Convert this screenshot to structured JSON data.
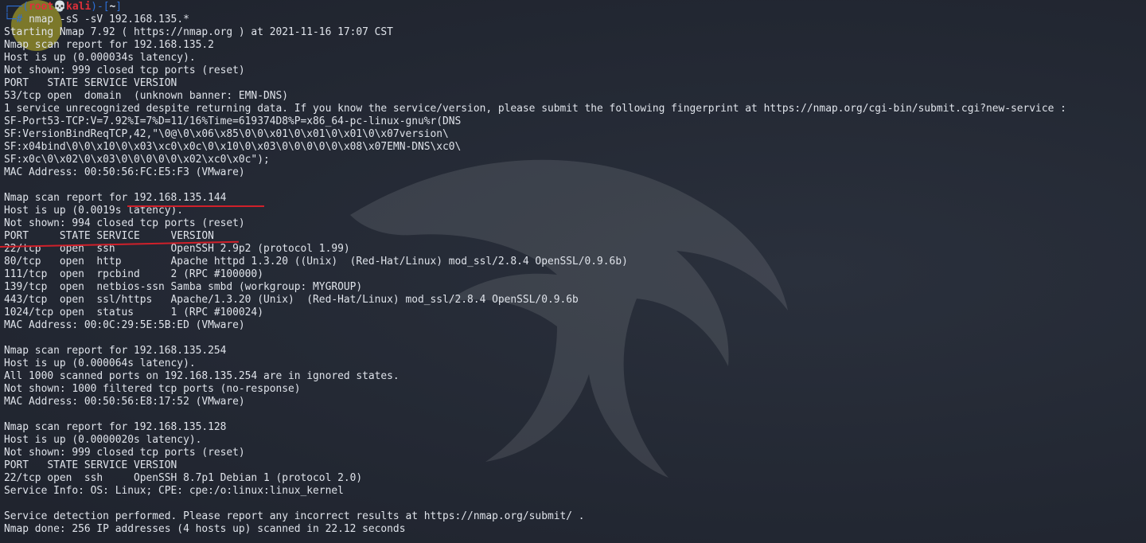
{
  "prompt": {
    "open": "┌──(",
    "user": "root",
    "skull": "💀",
    "host": "kali",
    "close": ")-[",
    "dir": "~",
    "end": "]",
    "corner": "└─",
    "hash": "# ",
    "command": "nmap -sS -sV 192.168.135.*"
  },
  "output": [
    "Starting Nmap 7.92 ( https://nmap.org ) at 2021-11-16 17:07 CST",
    "Nmap scan report for 192.168.135.2",
    "Host is up (0.000034s latency).",
    "Not shown: 999 closed tcp ports (reset)",
    "PORT   STATE SERVICE VERSION",
    "53/tcp open  domain  (unknown banner: EMN-DNS)",
    "1 service unrecognized despite returning data. If you know the service/version, please submit the following fingerprint at https://nmap.org/cgi-bin/submit.cgi?new-service :",
    "SF-Port53-TCP:V=7.92%I=7%D=11/16%Time=619374D8%P=x86_64-pc-linux-gnu%r(DNS",
    "SF:VersionBindReqTCP,42,\"\\0@\\0\\x06\\x85\\0\\0\\x01\\0\\x01\\0\\x01\\0\\x07version\\",
    "SF:x04bind\\0\\0\\x10\\0\\x03\\xc0\\x0c\\0\\x10\\0\\x03\\0\\0\\0\\0\\0\\x08\\x07EMN-DNS\\xc0\\",
    "SF:x0c\\0\\x02\\0\\x03\\0\\0\\0\\0\\0\\x02\\xc0\\x0c\");",
    "MAC Address: 00:50:56:FC:E5:F3 (VMware)",
    "",
    "Nmap scan report for 192.168.135.144",
    "Host is up (0.0019s latency).",
    "Not shown: 994 closed tcp ports (reset)",
    "PORT     STATE SERVICE     VERSION",
    "22/tcp   open  ssh         OpenSSH 2.9p2 (protocol 1.99)",
    "80/tcp   open  http        Apache httpd 1.3.20 ((Unix)  (Red-Hat/Linux) mod_ssl/2.8.4 OpenSSL/0.9.6b)",
    "111/tcp  open  rpcbind     2 (RPC #100000)",
    "139/tcp  open  netbios-ssn Samba smbd (workgroup: MYGROUP)",
    "443/tcp  open  ssl/https   Apache/1.3.20 (Unix)  (Red-Hat/Linux) mod_ssl/2.8.4 OpenSSL/0.9.6b",
    "1024/tcp open  status      1 (RPC #100024)",
    "MAC Address: 00:0C:29:5E:5B:ED (VMware)",
    "",
    "Nmap scan report for 192.168.135.254",
    "Host is up (0.000064s latency).",
    "All 1000 scanned ports on 192.168.135.254 are in ignored states.",
    "Not shown: 1000 filtered tcp ports (no-response)",
    "MAC Address: 00:50:56:E8:17:52 (VMware)",
    "",
    "Nmap scan report for 192.168.135.128",
    "Host is up (0.0000020s latency).",
    "Not shown: 999 closed tcp ports (reset)",
    "PORT   STATE SERVICE VERSION",
    "22/tcp open  ssh     OpenSSH 8.7p1 Debian 1 (protocol 2.0)",
    "Service Info: OS: Linux; CPE: cpe:/o:linux:linux_kernel",
    "",
    "Service detection performed. Please report any incorrect results at https://nmap.org/submit/ .",
    "Nmap done: 256 IP addresses (4 hosts up) scanned in 22.12 seconds"
  ],
  "colors": {
    "background": "#252a35",
    "text": "#dfe3ea",
    "prompt_blue": "#2d6fd6",
    "prompt_red": "#e0303a",
    "annotation_red": "#d0202a",
    "cursor_highlight": "#c8be28"
  },
  "icons": {
    "skull": "skull-icon",
    "background_logo": "kali-dragon-icon"
  }
}
